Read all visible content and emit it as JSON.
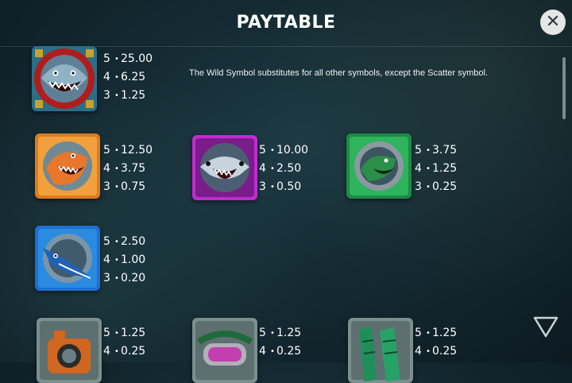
{
  "header": {
    "title": "PAYTABLE",
    "close_glyph": "✕"
  },
  "colors": {
    "wild_frame": "#b11c1c",
    "orange_frame": "#e07a1f",
    "purple_frame": "#c22bd0",
    "green_frame": "#1e8a45",
    "blue_frame": "#1f6fd0",
    "grey_frame": "#7b8f8e"
  },
  "wild": {
    "icon": "wild-shark-icon",
    "pays": [
      {
        "count": "5",
        "value": "25.00"
      },
      {
        "count": "4",
        "value": "6.25"
      },
      {
        "count": "3",
        "value": "1.25"
      }
    ],
    "description": "The Wild Symbol substitutes for all other symbols, except the Scatter symbol."
  },
  "symbols": [
    {
      "icon": "orange-shark-icon",
      "pays": [
        {
          "count": "5",
          "value": "12.50"
        },
        {
          "count": "4",
          "value": "3.75"
        },
        {
          "count": "3",
          "value": "0.75"
        }
      ]
    },
    {
      "icon": "purple-shark-icon",
      "pays": [
        {
          "count": "5",
          "value": "10.00"
        },
        {
          "count": "4",
          "value": "2.50"
        },
        {
          "count": "3",
          "value": "0.50"
        }
      ]
    },
    {
      "icon": "green-shark-icon",
      "pays": [
        {
          "count": "5",
          "value": "3.75"
        },
        {
          "count": "4",
          "value": "1.25"
        },
        {
          "count": "3",
          "value": "0.25"
        }
      ]
    },
    {
      "icon": "blue-swordfish-icon",
      "pays": [
        {
          "count": "5",
          "value": "2.50"
        },
        {
          "count": "4",
          "value": "1.00"
        },
        {
          "count": "3",
          "value": "0.20"
        }
      ]
    },
    {
      "icon": "underwater-camera-icon",
      "pays": [
        {
          "count": "5",
          "value": "1.25"
        },
        {
          "count": "4",
          "value": "0.25"
        }
      ]
    },
    {
      "icon": "diving-mask-icon",
      "pays": [
        {
          "count": "5",
          "value": "1.25"
        },
        {
          "count": "4",
          "value": "0.25"
        }
      ]
    },
    {
      "icon": "flippers-icon",
      "pays": [
        {
          "count": "5",
          "value": "1.25"
        },
        {
          "count": "4",
          "value": "0.25"
        }
      ]
    }
  ]
}
